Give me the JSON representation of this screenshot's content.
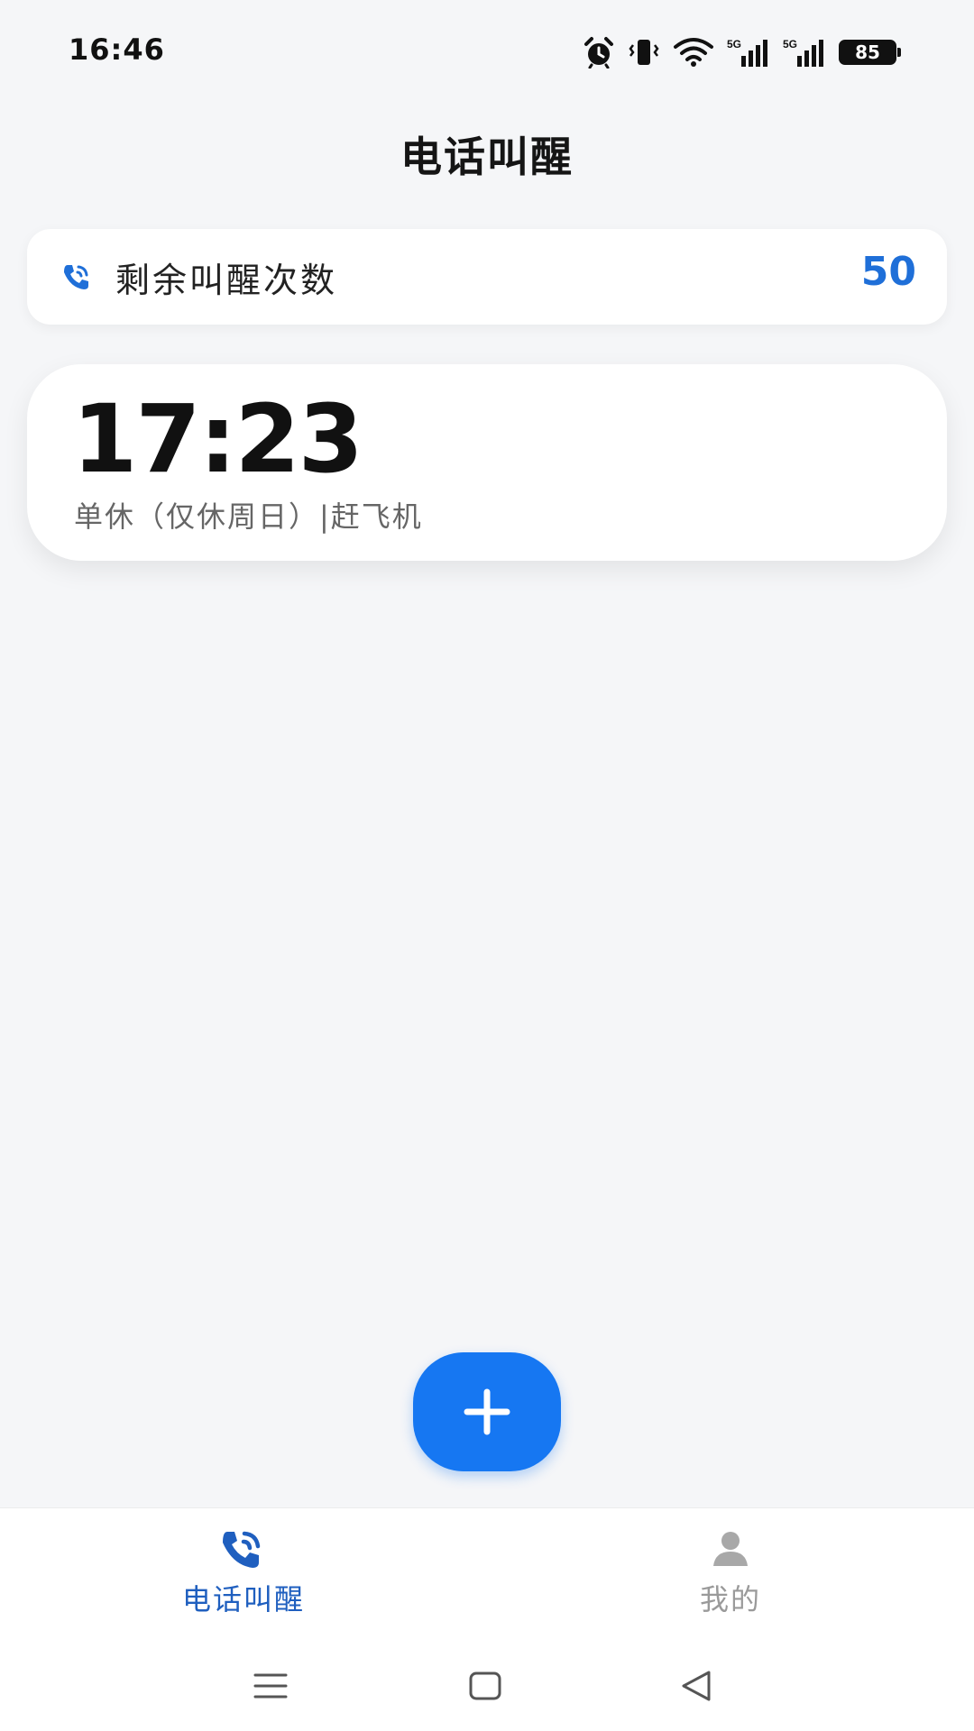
{
  "status_bar": {
    "time": "16:46",
    "icons": [
      "alarm-icon",
      "vibrate-icon",
      "wifi-icon",
      "signal-5g-icon",
      "signal-5g-icon",
      "battery-icon"
    ],
    "signal_label": "5G",
    "battery": "85"
  },
  "header": {
    "title": "电话叫醒"
  },
  "quota": {
    "icon": "phone-call-icon",
    "label": "剩余叫醒次数",
    "value": "50",
    "value_color": "#1f6fd8"
  },
  "alarms": [
    {
      "time": "17:23",
      "description": "单休（仅休周日）|赶飞机"
    }
  ],
  "fab": {
    "icon": "plus-icon",
    "color": "#1677f2"
  },
  "tabs": [
    {
      "label": "电话叫醒",
      "icon": "phone-call-icon",
      "active": true,
      "color": "#1f5fbf"
    },
    {
      "label": "我的",
      "icon": "person-icon",
      "active": false,
      "color": "#9a9a9a"
    }
  ],
  "system_nav": [
    "menu-icon",
    "home-icon",
    "back-icon"
  ]
}
